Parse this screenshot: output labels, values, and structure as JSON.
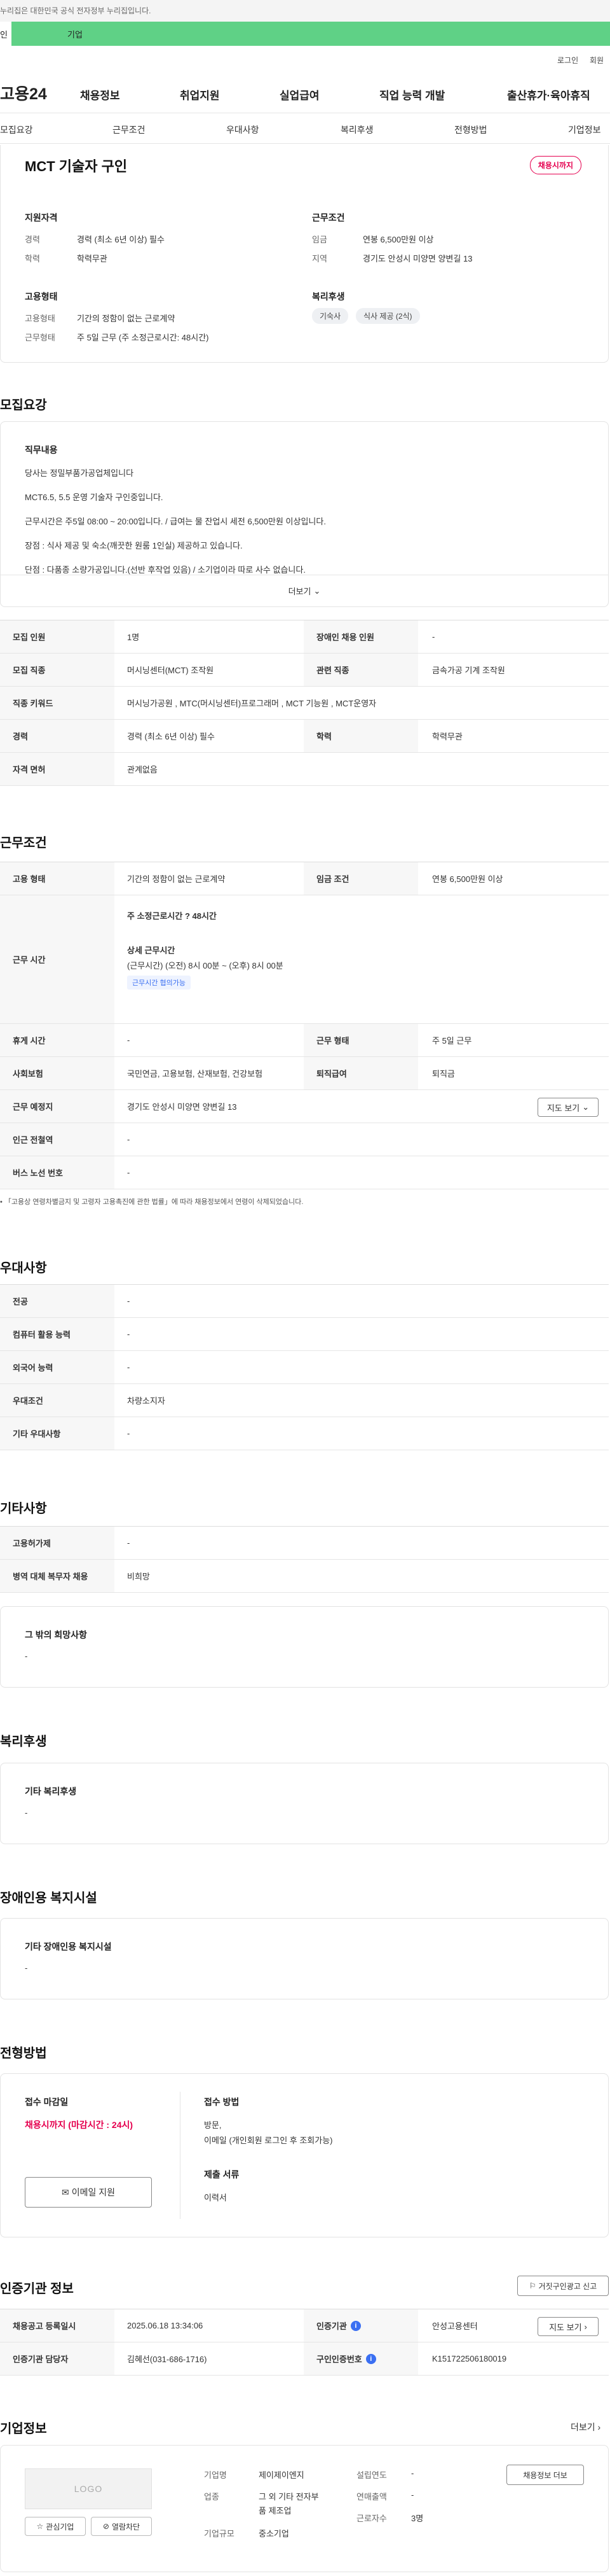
{
  "gov_notice": "누리집은 대한민국 공식 전자정부 누리집입니다.",
  "top_tabs": {
    "individual": "인",
    "business": "기업"
  },
  "util": {
    "login": "로그인",
    "join": "회원"
  },
  "gnb": {
    "logo": "고용24",
    "menu": [
      "채용정보",
      "취업지원",
      "실업급여",
      "직업 능력 개발",
      "출산휴가·육아휴직"
    ]
  },
  "anchors": [
    "모집요강",
    "근무조건",
    "우대사항",
    "복리후생",
    "전형방법",
    "기업정보"
  ],
  "summary": {
    "title": "MCT 기술자 구인",
    "status_badge": "채용시까지",
    "qualification_title": "지원자격",
    "career_label": "경력",
    "career_value": "경력 (최소 6년 이상) 필수",
    "education_label": "학력",
    "education_value": "학력무관",
    "conditions_title": "근무조건",
    "wage_label": "임금",
    "wage_value": "연봉 6,500만원 이상",
    "region_label": "지역",
    "region_value": "경기도 안성시 미양면 양변길 13",
    "employment_title": "고용형태",
    "emp_type_label": "고용형태",
    "emp_type_value": "기간의 정함이 없는 근로계약",
    "work_type_label": "근무형태",
    "work_type_value": "주 5일 근무 (주 소정근로시간: 48시간)",
    "welfare_title": "복리후생",
    "welfare_tags": [
      "기숙사",
      "식사 제공 (2식)"
    ]
  },
  "recruit": {
    "section_title": "모집요강",
    "job_desc_title": "직무내용",
    "job_desc_lines": [
      "당사는 정밀부품가공업체입니다",
      "MCT6.5, 5.5 운영 기술자 구인중입니다.",
      "근무시간은 주5일 08:00 ~ 20:00입니다. / 급여는 물 잔업시 세전 6,500만원 이상입니다.",
      "장점 : 식사 제공 및 숙소(깨끗한 원룸 1인실) 제공하고 있습니다.",
      "단점 : 다품종 소량가공입니다.(선반 후작업 있음) / 소기업이라 따로 사수 없습니다."
    ],
    "more_label": "더보기",
    "table": {
      "headcount_label": "모집 인원",
      "headcount_value": "1명",
      "disabled_label": "장애인 채용 인원",
      "disabled_value": "-",
      "job_label": "모집 직종",
      "job_value": "머시닝센터(MCT) 조작원",
      "related_label": "관련 직종",
      "related_value": "금속가공 기계 조작원",
      "keyword_label": "직종 키워드",
      "keyword_value": "머시닝가공원 , MTC(머시닝센터)프로그래머 , MCT 기능원 , MCT운영자",
      "career_label": "경력",
      "career_value": "경력 (최소 6년 이상) 필수",
      "edu_label": "학력",
      "edu_value": "학력무관",
      "license_label": "자격 면허",
      "license_value": "관계없음"
    }
  },
  "work": {
    "section_title": "근무조건",
    "type_label": "고용 형태",
    "type_value": "기간의 정함이 없는 근로계약",
    "wage_label": "임금 조건",
    "wage_value": "연봉 6,500만원 이상",
    "hours_label": "근무 시간",
    "weekly_hours": "주 소정근로시간 ? 48시간",
    "detail_title": "상세 근무시간",
    "detail_value": "(근무시간) (오전) 8시 00분 ~ (오후) 8시 00분",
    "flex_tag": "근무시간 협의가능",
    "break_label": "휴게 시간",
    "break_value": "-",
    "shift_label": "근무 형태",
    "shift_value": "주 5일 근무",
    "insurance_label": "사회보험",
    "insurance_value": "국민연금, 고용보험, 산재보험, 건강보험",
    "retire_label": "퇴직급여",
    "retire_value": "퇴직금",
    "place_label": "근무 예정지",
    "place_value": "경기도 안성시 미양면 양변길 13",
    "map_button": "지도 보기",
    "subway_label": "인근 전철역",
    "subway_value": "-",
    "bus_label": "버스 노선 번호",
    "bus_value": "-",
    "note": "「고용상 연령차별금지 및 고령자 고용촉진에 관한 법률」에 따라 채용정보에서 연령이 삭제되었습니다."
  },
  "preferred": {
    "section_title": "우대사항",
    "rows": [
      {
        "label": "전공",
        "value": "-"
      },
      {
        "label": "컴퓨터 활용 능력",
        "value": "-"
      },
      {
        "label": "외국어 능력",
        "value": "-"
      },
      {
        "label": "우대조건",
        "value": "차량소지자"
      },
      {
        "label": "기타 우대사항",
        "value": "-"
      }
    ]
  },
  "etc": {
    "section_title": "기타사항",
    "rows": [
      {
        "label": "고용허가제",
        "value": "-"
      },
      {
        "label": "병역 대체 복무자 채용",
        "value": "비희망"
      }
    ],
    "other_title": "그 밖의 희망사항",
    "other_value": "-"
  },
  "welfare": {
    "section_title": "복리후생",
    "box_title": "기타 복리후생",
    "box_value": "-"
  },
  "disability": {
    "section_title": "장애인용 복지시설",
    "box_title": "기타 장애인용 복지시설",
    "box_value": "-"
  },
  "selection": {
    "section_title": "전형방법",
    "deadline_title": "접수 마감일",
    "deadline_value": "채용시까지 (마감시간 : 24시)",
    "email_button": "이메일 지원",
    "method_title": "접수 방법",
    "method_value_1": "방문,",
    "method_value_2": "이메일 (개인회원 로그인 후 조회가능)",
    "docs_title": "제출 서류",
    "docs_value": "이력서"
  },
  "agency": {
    "section_title": "인증기관 정보",
    "report_button": "거짓구인광고 신고",
    "reg_label": "채용공고 등록일시",
    "reg_value": "2025.06.18 13:34:06",
    "agency_label": "인증기관",
    "agency_value": "안성고용센터",
    "map_button": "지도 보기",
    "manager_label": "인증기관 담당자",
    "manager_value": "김혜선(031-686-1716)",
    "no_label": "구인인증번호",
    "no_value": "K151722506180019"
  },
  "company": {
    "section_title": "기업정보",
    "more_label": "더보기",
    "logo_text": "LOGO",
    "interest_button": "관심기업",
    "block_button": "열람차단",
    "name_label": "기업명",
    "name_value": "제이제이엔지",
    "industry_label": "업종",
    "industry_value_1": "그 외 기타 전자부",
    "industry_value_2": "품 제조업",
    "size_label": "기업규모",
    "size_value": "중소기업",
    "founded_label": "설립연도",
    "founded_value": "-",
    "revenue_label": "연매출액",
    "revenue_value": "-",
    "employees_label": "근로자수",
    "employees_value": "3명",
    "jobs_button": "채용정보 더보"
  }
}
